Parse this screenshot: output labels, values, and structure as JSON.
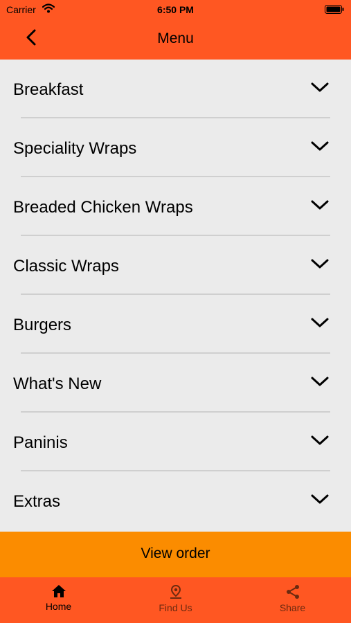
{
  "status_bar": {
    "carrier": "Carrier",
    "time": "6:50 PM"
  },
  "nav": {
    "title": "Menu"
  },
  "menu": {
    "items": [
      {
        "label": "Breakfast"
      },
      {
        "label": "Speciality Wraps"
      },
      {
        "label": "Breaded Chicken Wraps"
      },
      {
        "label": "Classic Wraps"
      },
      {
        "label": "Burgers"
      },
      {
        "label": "What's New"
      },
      {
        "label": "Paninis"
      },
      {
        "label": "Extras"
      }
    ]
  },
  "view_order": {
    "label": "View order"
  },
  "tabs": [
    {
      "label": "Home",
      "icon": "home-icon"
    },
    {
      "label": "Find Us",
      "icon": "map-pin-icon"
    },
    {
      "label": "Share",
      "icon": "share-icon"
    }
  ],
  "colors": {
    "header_bg": "#ff5722",
    "list_bg": "#ebebeb",
    "view_order_bg": "#fb8c00"
  }
}
